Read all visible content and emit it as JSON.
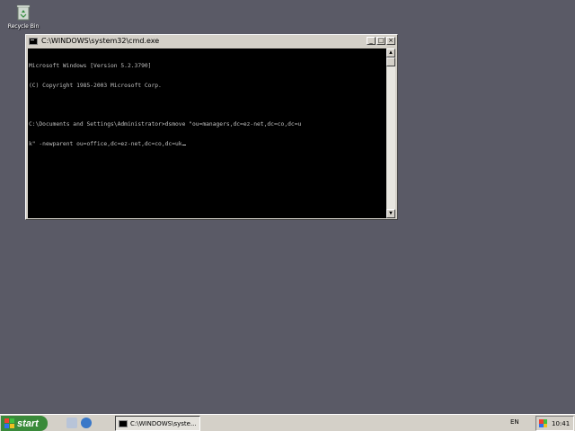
{
  "desktop": {
    "recycle_bin_label": "Recycle Bin"
  },
  "window": {
    "title": "C:\\WINDOWS\\system32\\cmd.exe",
    "buttons": {
      "minimize": "_",
      "maximize": "□",
      "close": "×"
    },
    "console_lines": [
      "Microsoft Windows [Version 5.2.3790]",
      "(C) Copyright 1985-2003 Microsoft Corp.",
      "",
      "C:\\Documents and Settings\\Administrator>dsmove \"ou=managers,dc=ez-net,dc=co,dc=u",
      "k\" -newparent ou=office,dc=ez-net,dc=co,dc=uk"
    ]
  },
  "taskbar": {
    "start_label": "start",
    "task_button_label": "C:\\WINDOWS\\syste...",
    "language": "EN",
    "clock": "10:41"
  },
  "colors": {
    "desktop_bg": "#5a5a66",
    "start_green": "#3a8a3a",
    "console_bg": "#000000",
    "console_fg": "#c0c0c0"
  }
}
